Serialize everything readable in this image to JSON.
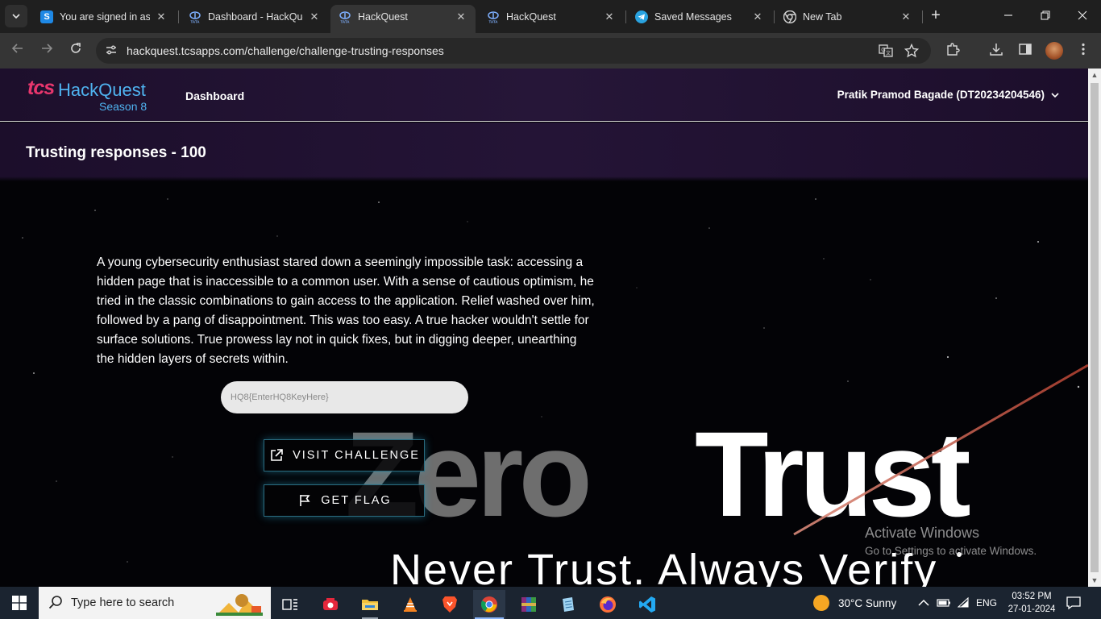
{
  "browser": {
    "tabs": [
      {
        "title": "You are signed in as M",
        "favicon": "S"
      },
      {
        "title": "Dashboard - HackQuest",
        "favicon": "TATA"
      },
      {
        "title": "HackQuest",
        "favicon": "TATA"
      },
      {
        "title": "HackQuest",
        "favicon": "TATA"
      },
      {
        "title": "Saved Messages",
        "favicon": "telegram-icon"
      },
      {
        "title": "New Tab",
        "favicon": "chrome-icon"
      }
    ],
    "active_tab_index": 2,
    "url": "hackquest.tcsapps.com/challenge/challenge-trusting-responses"
  },
  "site": {
    "logo_tcs": "tcs",
    "logo_name": "HackQuest",
    "logo_season": "Season 8",
    "nav_dashboard": "Dashboard",
    "user": "Pratik Pramod Bagade (DT20234204546)",
    "accent_color": "#4fb3f0",
    "brand_color": "#e8366d"
  },
  "challenge": {
    "title": "Trusting responses - 100",
    "description": "A young cybersecurity enthusiast stared down a seemingly impossible task: accessing a hidden page that is inaccessible to a common user. With a sense of cautious optimism, he tried in the classic combinations to gain access to the application. Relief washed over him, followed by a pang of disappointment. This was too easy. A true hacker wouldn't settle for surface solutions. True prowess lay not in quick fixes, but in digging deeper, unearthing the hidden layers of secrets within.",
    "flag_placeholder": "HQ8{EnterHQ8KeyHere}",
    "flag_value": "",
    "visit_label": "VISIT CHALLENGE",
    "flag_label": "GET FLAG"
  },
  "banner": {
    "word1": "Zero",
    "word2": "Trust",
    "tagline": "Never Trust. Always Verify"
  },
  "watermark": {
    "line1": "Activate Windows",
    "line2": "Go to Settings to activate Windows."
  },
  "taskbar": {
    "search_placeholder": "Type here to search",
    "weather": "30°C  Sunny",
    "language": "ENG",
    "time": "03:52 PM",
    "date": "27-01-2024"
  }
}
